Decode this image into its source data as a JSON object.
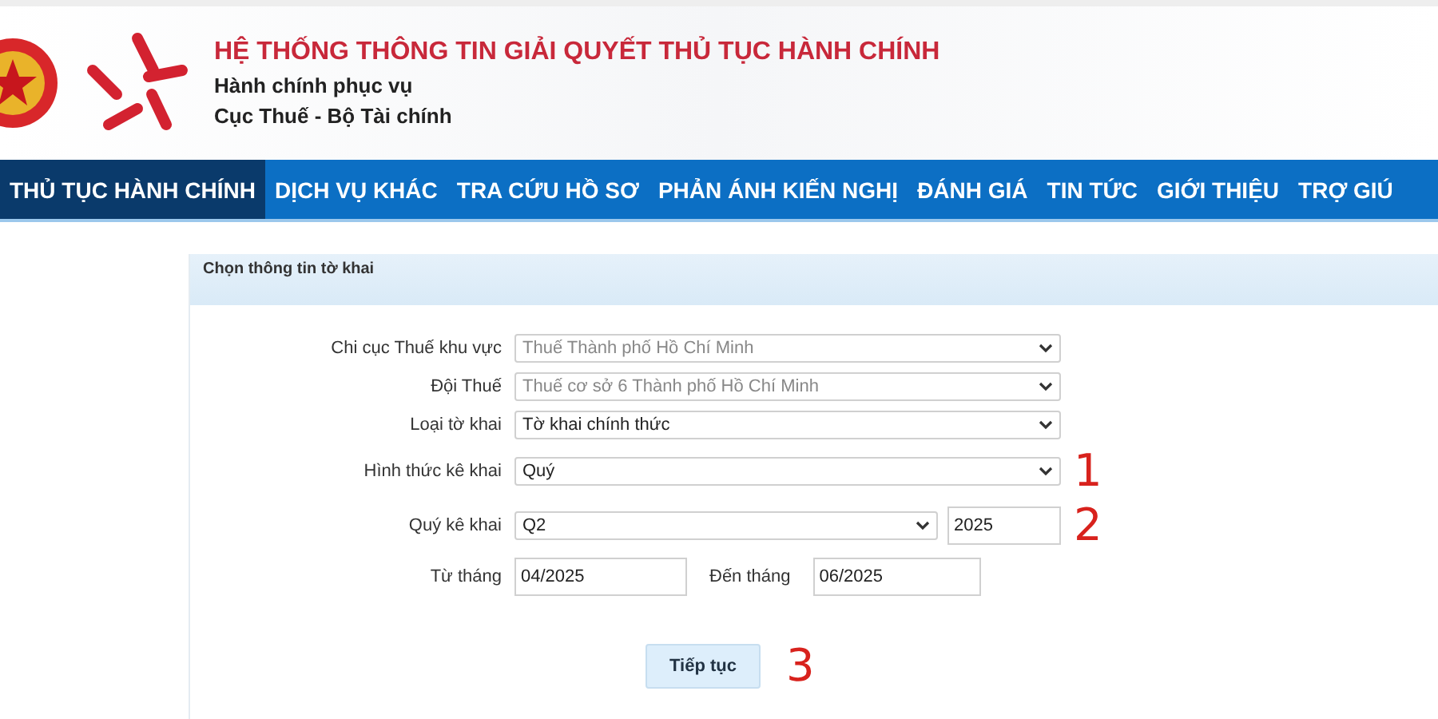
{
  "header": {
    "title": "HỆ THỐNG THÔNG TIN GIẢI QUYẾT THỦ TỤC HÀNH CHÍNH",
    "subtitle": "Hành chính phục vụ",
    "agency": "Cục Thuế - Bộ Tài chính"
  },
  "nav": [
    {
      "label": "THỦ TỤC HÀNH CHÍNH",
      "selected": true
    },
    {
      "label": "DỊCH VỤ KHÁC",
      "selected": false
    },
    {
      "label": "TRA CỨU HỒ SƠ",
      "selected": false
    },
    {
      "label": "PHẢN ÁNH KIẾN NGHỊ",
      "selected": false
    },
    {
      "label": "ĐÁNH GIÁ",
      "selected": false
    },
    {
      "label": "TIN TỨC",
      "selected": false
    },
    {
      "label": "GIỚI THIỆU",
      "selected": false
    },
    {
      "label": "TRỢ GIÚ",
      "selected": false
    }
  ],
  "panel": {
    "title": "Chọn thông tin tờ khai",
    "rows": [
      {
        "kind": "select",
        "label": "Chi cục Thuế khu vực",
        "value": "Thuế Thành phố Hồ Chí Minh",
        "disabled": true
      },
      {
        "kind": "select",
        "label": "Đội Thuế",
        "value": "Thuế cơ sở 6 Thành phố Hồ Chí Minh",
        "disabled": true
      },
      {
        "kind": "select",
        "label": "Loại tờ khai",
        "value": "Tờ khai chính thức",
        "disabled": false
      },
      {
        "kind": "select",
        "label": "Hình thức kê khai",
        "value": "Quý",
        "disabled": false,
        "annotation": "1"
      },
      {
        "kind": "select-year",
        "label": "Quý kê khai",
        "value": "Q2",
        "year": "2025",
        "disabled": false,
        "annotation": "2"
      },
      {
        "kind": "range",
        "label": "Từ tháng",
        "value": "04/2025",
        "label_2": "Đến tháng",
        "value_2": "06/2025"
      }
    ],
    "button": {
      "label": "Tiếp tục",
      "annotation": "3"
    }
  }
}
